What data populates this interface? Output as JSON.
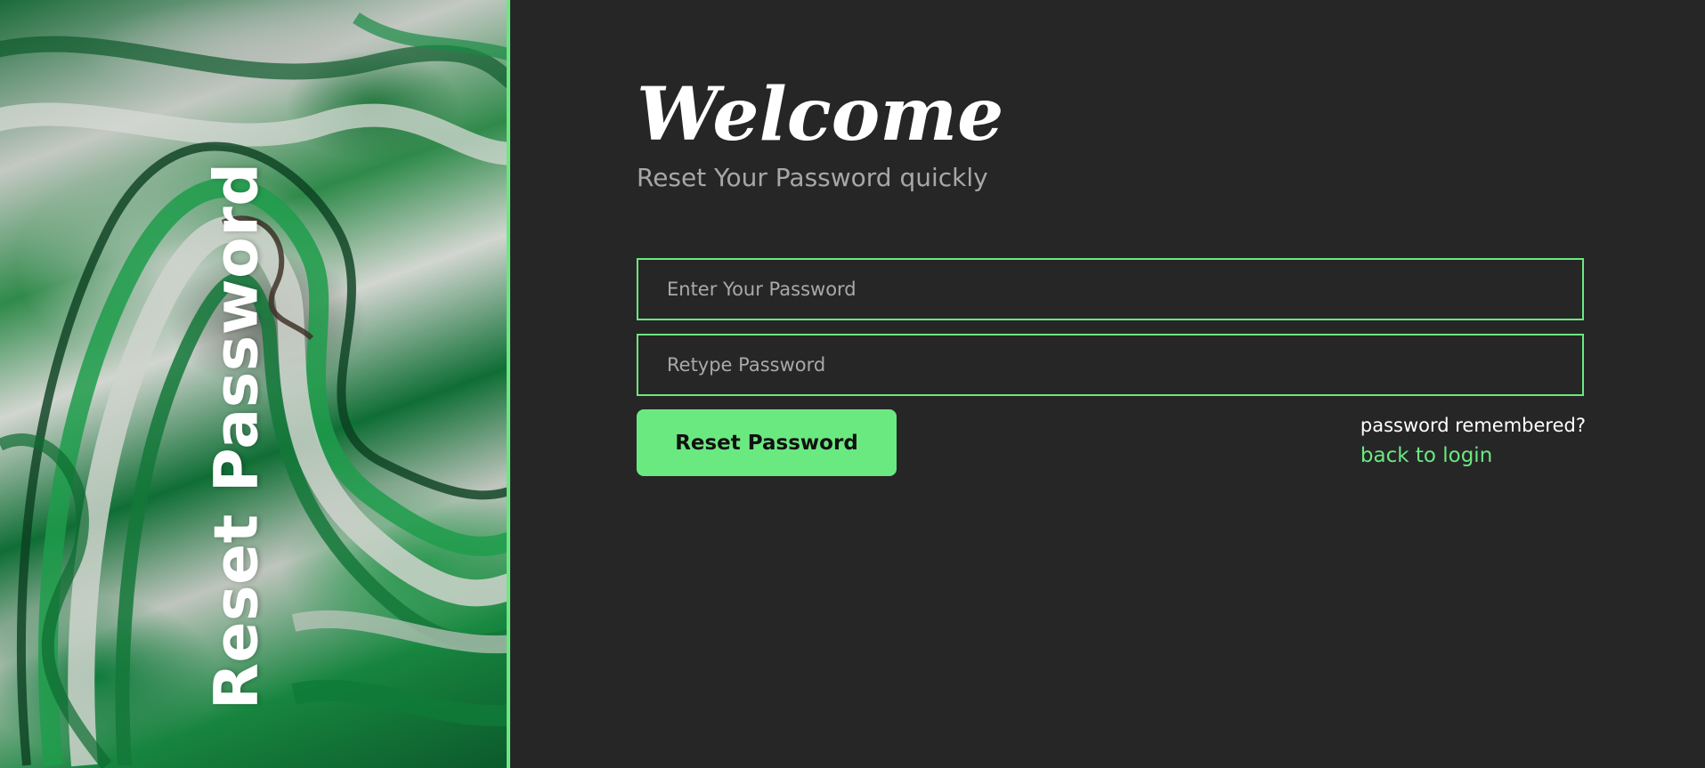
{
  "side_panel": {
    "title": "Reset Password",
    "background_image": "green-marble-texture"
  },
  "header": {
    "welcome": "Welcome",
    "subtitle": "Reset Your Password quickly"
  },
  "form": {
    "password": {
      "value": "",
      "placeholder": "Enter Your Password"
    },
    "retype_password": {
      "value": "",
      "placeholder": "Retype Password"
    },
    "submit_label": "Reset Password"
  },
  "footer_links": {
    "remembered_text": "password remembered?",
    "back_to_login_label": "back to login"
  },
  "colors": {
    "accent": "#6ae981",
    "background": "#262626",
    "subtitle_text": "#a7a7a7",
    "primary_text": "#ffffff"
  }
}
